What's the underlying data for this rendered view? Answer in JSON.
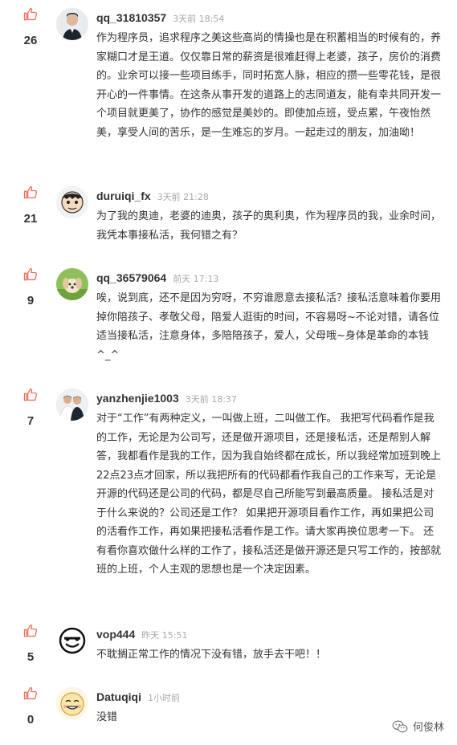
{
  "comments": [
    {
      "likes": "26",
      "username": "qq_31810357",
      "time": "3天前 18:54",
      "text": "作为程序员，追求程序之美这些高尚的情操也是在积蓄相当的时候有的，养家糊口才是王道。仅仅靠日常的薪资是很难赶得上老婆，孩子，房价的消费的。业余可以接一些项目练手，同时拓宽人脉，相应的攒一些零花钱，是很开心的一件事情。在这条从事开发的道路上的志同道友，能有幸共同开发一个项目就更美了，协作的感觉是美妙的。即使加点班，受点累，午夜怡然美，享受人间的苦乐，是一生难忘的岁月。一起走过的朋友，加油呦！"
    },
    {
      "likes": "21",
      "username": "duruiqi_fx",
      "time": "3天前 21:28",
      "text": "为了我的奥迪，老婆的迪奥，孩子的奥利奥，作为程序员的我，业余时间，我凭本事接私活，我何错之有？"
    },
    {
      "likes": "9",
      "username": "qq_36579064",
      "time": "前天 17:13",
      "text": "唉，说到底，还不是因为穷呀，不穷谁愿意去接私活？接私活意味着你要用掉你陪孩子、孝敬父母，陪爱人逛街的时间，不容易呀~不论对错，请各位适当接私活，注意身体，多陪陪孩子，爱人，父母哦~身体是革命的本钱^_^"
    },
    {
      "likes": "7",
      "username": "yanzhenjie1003",
      "time": "3天前 18:37",
      "text": "对于“工作”有两种定义，一叫做上班，二叫做工作。 我把写代码看作是我的工作，无论是为公司写，还是做开源项目，还是接私活，还是帮别人解答，我都看作是我的工作，因为我自始终都在成长，所以我经常加班到晚上22点23点才回家，所以我把所有的代码都看作我自己的工作来写，无论是开源的代码还是公司的代码，都是尽自己所能写到最高质量。 接私活是对于什么来说的？公司还是工作？ 如果把开源项目看作工作，再如果把公司的活看作工作，再如果把接私活看作是工作。请大家再换位思考一下。 还有看你喜欢做什么样的工作了，接私活还是做开源还是只写工作的，按部就班的上班，个人主观的思想也是一个决定因素。"
    },
    {
      "likes": "5",
      "username": "vop444",
      "time": "昨天 15:51",
      "text": "不耽搁正常工作的情况下没有错，放手去干吧！！"
    },
    {
      "likes": "0",
      "username": "Datuqiqi",
      "time": "1小时前",
      "text": "没错"
    }
  ],
  "watermark": {
    "text": "何俊林"
  },
  "colors": {
    "like_icon": "#e8735f",
    "time": "#a8a8a8",
    "text": "#333333"
  }
}
